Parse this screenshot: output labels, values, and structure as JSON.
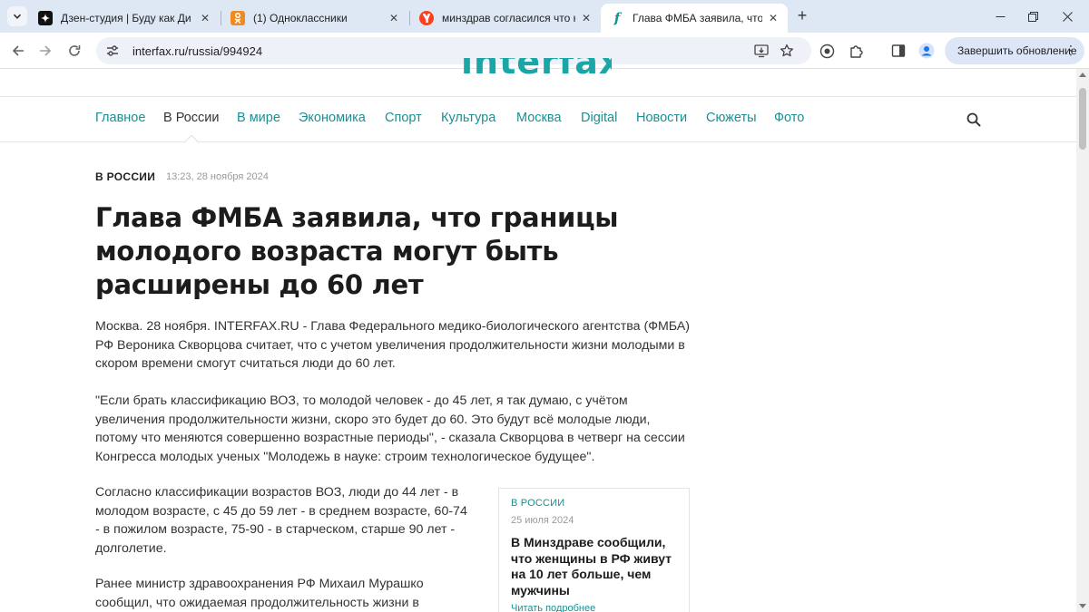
{
  "browser": {
    "tabs": [
      {
        "title": "Дзен-студия | Буду как Ди Кап",
        "favicon": "dzen-icon",
        "active": false
      },
      {
        "title": "(1) Одноклассники",
        "favicon": "odnoklassniki-icon",
        "active": false
      },
      {
        "title": "минздрав согласился что над",
        "favicon": "yandex-icon",
        "active": false
      },
      {
        "title": "Глава ФМБА заявила, что гран",
        "favicon": "interfax-icon",
        "active": true
      }
    ],
    "new_tab_symbol": "+",
    "address": "interfax.ru/russia/994924",
    "update_button": "Завершить обновление",
    "colors": {
      "tabstrip": "#dee7f4",
      "accent": "#1b8f92"
    }
  },
  "site": {
    "nav": [
      {
        "label": "Главное",
        "current": false
      },
      {
        "label": "В России",
        "current": true
      },
      {
        "label": "В мире",
        "current": false
      },
      {
        "label": "Экономика",
        "current": false
      },
      {
        "label": "Спорт",
        "current": false
      },
      {
        "label": "Культура",
        "current": false
      },
      {
        "label": "Москва",
        "current": false
      },
      {
        "label": "Digital",
        "current": false
      },
      {
        "label": "Новости",
        "current": false
      },
      {
        "label": "Сюжеты",
        "current": false
      },
      {
        "label": "Фото",
        "current": false
      }
    ]
  },
  "article": {
    "rubric": "В РОССИИ",
    "datetime": "13:23, 28 ноября 2024",
    "headline": "Глава ФМБА заявила, что границы молодого возраста могут быть расширены до 60 лет",
    "paragraphs": [
      "Москва. 28 ноября. INTERFAX.RU - Глава Федерального медико-биологического агентства (ФМБА) РФ Вероника Скворцова считает, что с учетом увеличения продолжительности жизни молодыми в скором времени смогут считаться люди до 60 лет.",
      "\"Если брать классификацию ВОЗ, то молодой человек - до 45 лет, я так думаю, с учётом увеличения продолжительности жизни, скоро это будет до 60. Это будут всё молодые люди, потому что меняются совершенно возрастные периоды\", - сказала Скворцова в четверг на сессии Конгресса молодых ученых \"Молодежь в науке: строим технологическое будущее\".",
      "Согласно классификации возрастов ВОЗ, люди до 44 лет - в молодом возрасте, с 45 до 59 лет - в среднем возрасте, 60-74 - в пожилом возрасте, 75-90 - в старческом, старше 90 лет - долголетие.",
      "Ранее министр здравоохранения РФ Михаил Мурашко сообщил, что ожидаемая продолжительность жизни в"
    ]
  },
  "related": {
    "rubric": "В РОССИИ",
    "date": "25 июля 2024",
    "title": "В Минздраве сообщили, что женщины в РФ живут на 10 лет больше, чем мужчины",
    "more": "Читать подробнее"
  }
}
